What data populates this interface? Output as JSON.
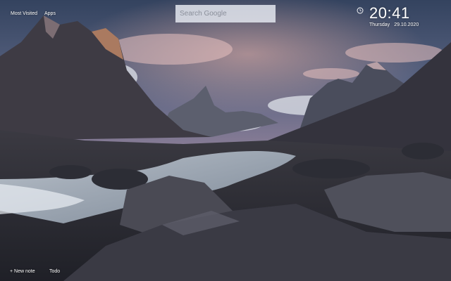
{
  "nav": {
    "most_visited": "Most Visited",
    "apps": "Apps"
  },
  "search": {
    "placeholder": "Search Google"
  },
  "clock": {
    "icon": "clock-icon",
    "time": "20:41",
    "weekday": "Thursday",
    "date": "29.10.2020"
  },
  "footer": {
    "new_note": "+ New note",
    "todo": "Todo"
  },
  "colors": {
    "sky_top": "#3a4a66",
    "sky_mid": "#7b6f8c",
    "cloud_pink": "#d9a0a8",
    "rock_dark": "#2a2c35",
    "water": "#a9b6c4"
  }
}
